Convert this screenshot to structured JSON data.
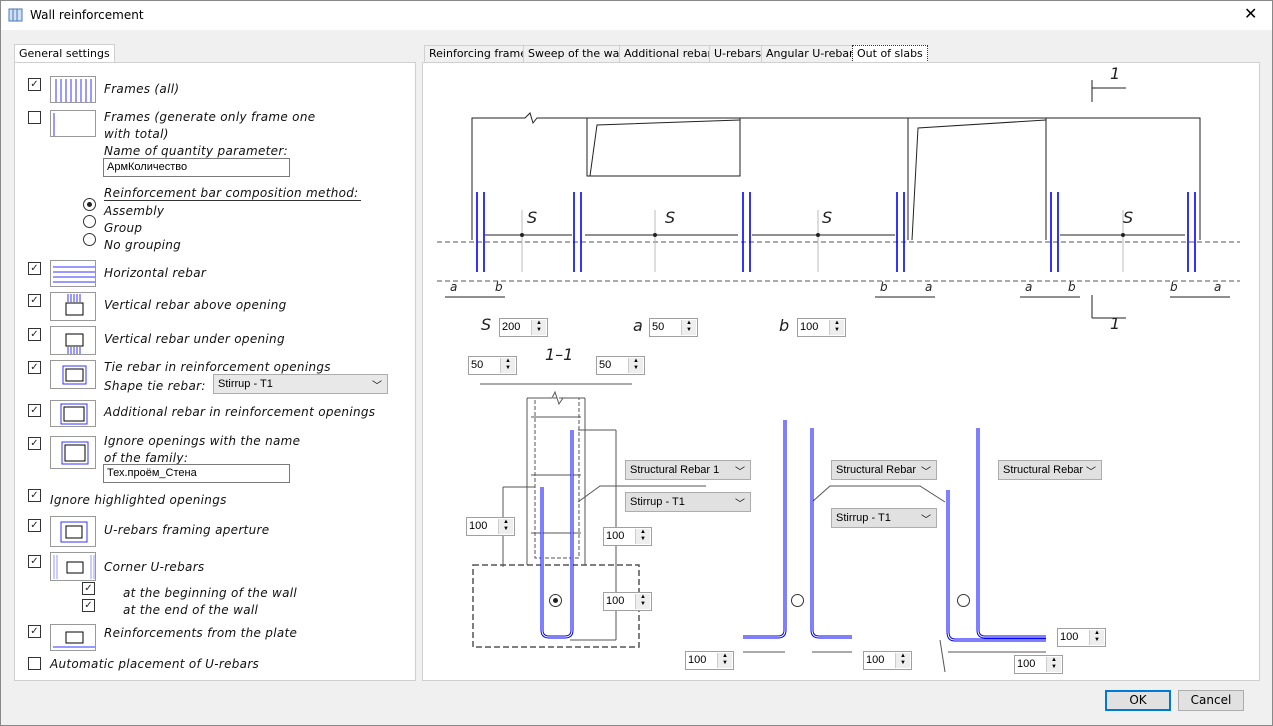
{
  "window": {
    "title": "Wall reinforcement",
    "close_icon": "close-icon",
    "app_icon": "wall-icon"
  },
  "left": {
    "tab": "General settings",
    "frames_all": {
      "label": "Frames (all)",
      "checked": true
    },
    "frames_one": {
      "label1": "Frames (generate only frame one",
      "label2": "with total)",
      "checked": false
    },
    "qty_param": {
      "label": "Name of quantity parameter:",
      "value": "АрмКоличество"
    },
    "composition": {
      "label": "Reinforcement bar composition method:",
      "options": [
        "Assembly",
        "Group",
        "No grouping"
      ],
      "selected": "Assembly"
    },
    "horizontal": {
      "label": "Horizontal rebar",
      "checked": true
    },
    "vert_above": {
      "label": "Vertical rebar above opening",
      "checked": true
    },
    "vert_under": {
      "label": "Vertical rebar under opening",
      "checked": true
    },
    "tie": {
      "label": "Tie rebar in reinforcement openings",
      "checked": true,
      "shape_label": "Shape tie rebar:",
      "shape_value": "Stirrup - T1"
    },
    "additional": {
      "label": "Additional rebar in reinforcement openings",
      "checked": true
    },
    "ignore_family": {
      "label1": "Ignore openings with the name",
      "label2": "of the family:",
      "checked": true,
      "value": "Тех.проём_Стена"
    },
    "ignore_highlighted": {
      "label": "Ignore highlighted openings",
      "checked": true
    },
    "u_framing": {
      "label": "U-rebars framing aperture",
      "checked": true
    },
    "corner": {
      "label": "Corner U-rebars",
      "checked": true,
      "begin": "at the beginning of the wall",
      "end": "at the end of the wall",
      "begin_checked": true,
      "end_checked": true
    },
    "plate": {
      "label": "Reinforcements from the plate",
      "checked": true
    },
    "auto_u": {
      "label": "Automatic placement of U-rebars",
      "checked": false
    }
  },
  "tabs": [
    "Reinforcing frames",
    "Sweep of the wall",
    "Additional rebars",
    "U-rebars",
    "Angular U-rebars",
    "Out of slabs"
  ],
  "active_tab": "Out of slabs",
  "drawing": {
    "section_mark": "1",
    "section_title": "1–1",
    "s_label": "S",
    "a_label": "a",
    "b_label": "b",
    "s_value": "200",
    "a_value": "50",
    "b_value": "100",
    "top_left_cover": "50",
    "top_right_cover": "50",
    "left_anchor": "100",
    "right_upper": "100",
    "right_lower": "100",
    "mid_left_leg": "100",
    "mid_right_leg": "100",
    "right_leg_top": "100",
    "right_leg_bottom": "100",
    "select1": "Structural Rebar 1",
    "select2": "Stirrup - T1",
    "select3": "Structural Rebar",
    "select4": "Stirrup - T1",
    "select5": "Structural Rebar",
    "rebar_option_selected": 1
  },
  "buttons": {
    "ok": "OK",
    "cancel": "Cancel"
  },
  "colors": {
    "rebar": "#0000ff",
    "accent": "#0078d7"
  }
}
